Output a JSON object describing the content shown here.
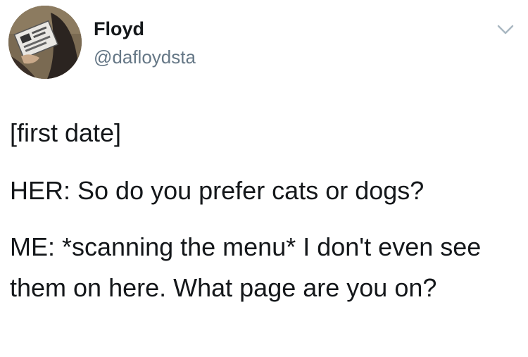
{
  "tweet": {
    "display_name": "Floyd",
    "handle": "@dafloydsta",
    "menu_icon": "chevron-down-icon",
    "avatar_icon": "avatar",
    "paragraphs": [
      "[first date]",
      "HER: So do you prefer cats or dogs?",
      "ME: *scanning the menu* I don't even see them on here. What page are you on?"
    ]
  },
  "colors": {
    "text": "#14171a",
    "secondary_text": "#657786",
    "chevron": "#aab8c2",
    "background": "#ffffff"
  }
}
